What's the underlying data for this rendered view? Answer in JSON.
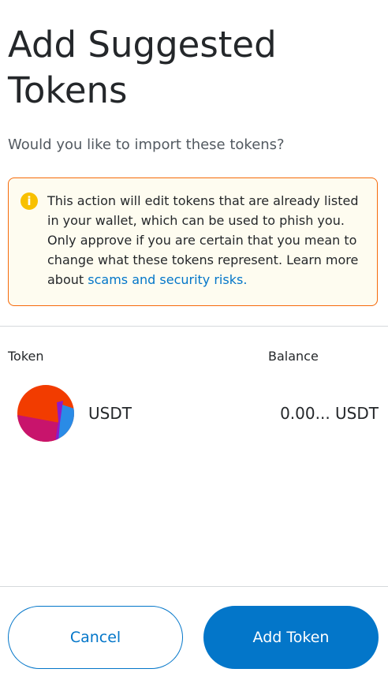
{
  "header": {
    "title": "Add Suggested Tokens",
    "subtitle": "Would you like to import these tokens?"
  },
  "warning": {
    "icon": "info-icon",
    "text": "This action will edit tokens that are already listed in your wallet, which can be used to phish you. Only approve if you are certain that you mean to change what these tokens represent. Learn more about ",
    "link_text": "scams and security risks.",
    "border_color": "#f66a0a",
    "background_color": "#fefcf0"
  },
  "table": {
    "columns": {
      "token": "Token",
      "balance": "Balance"
    },
    "rows": [
      {
        "symbol": "USDT",
        "balance": "0.00... USDT",
        "icon": "jazzicon-avatar"
      }
    ]
  },
  "actions": {
    "cancel_label": "Cancel",
    "add_label": "Add Token",
    "primary_color": "#0376c9"
  }
}
